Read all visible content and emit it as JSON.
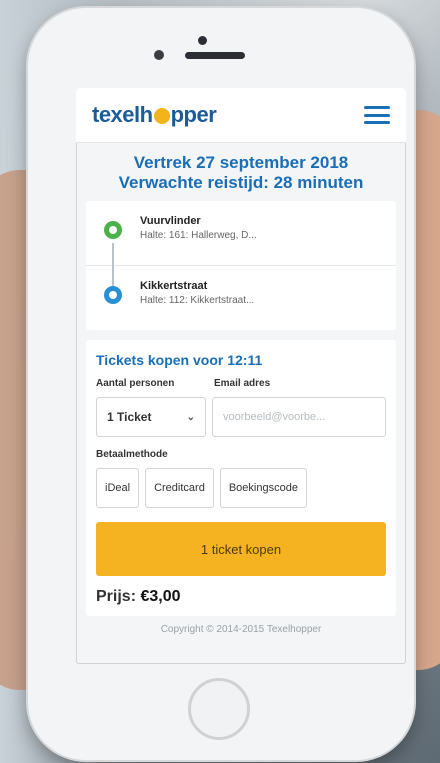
{
  "app": {
    "logo_text_a": "texelh",
    "logo_text_b": "pper",
    "menu_icon": "hamburger-menu-icon"
  },
  "trip": {
    "departure": "Vertrek 27 september 2018",
    "duration": "Verwachte reistijd: 28 minuten"
  },
  "stops": [
    {
      "name": "Vuurvlinder",
      "detail": "Halte: 161: Hallerweg, D...",
      "color": "#4bb24a"
    },
    {
      "name": "Kikkertstraat",
      "detail": "Halte: 112: Kikkertstraat...",
      "color": "#2b8fd6"
    }
  ],
  "tickets": {
    "title": "Tickets kopen voor 12:11",
    "persons_label": "Aantal personen",
    "email_label": "Email adres",
    "persons_value": "1 Ticket",
    "email_placeholder": "voorbeeld@voorbe...",
    "payment_label": "Betaalmethode",
    "payment_options": [
      "iDeal",
      "Creditcard",
      "Boekingscode"
    ],
    "buy_label": "1 ticket kopen",
    "price_label": "Prijs:",
    "price_value": "€3,00"
  },
  "footer": {
    "copyright": "Copyright © 2014-2015 Texelhopper"
  },
  "colors": {
    "brand_blue": "#1a6eb5",
    "accent_yellow": "#f5b321"
  }
}
